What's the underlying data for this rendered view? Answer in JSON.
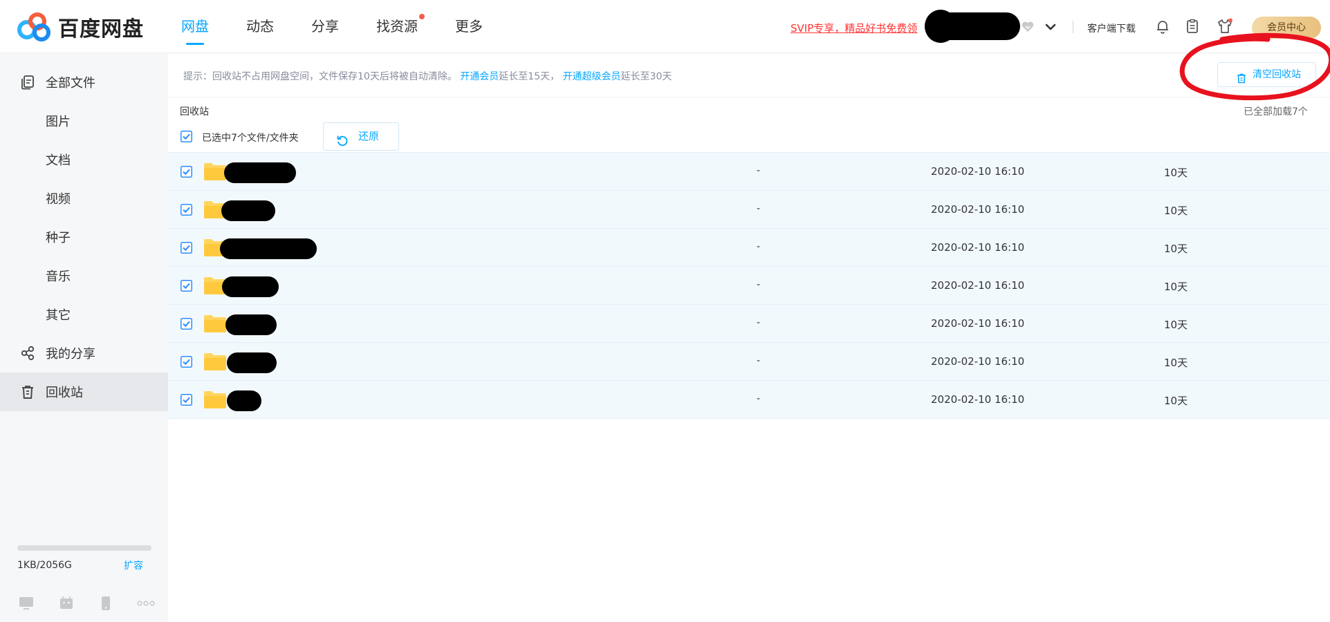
{
  "app": {
    "name": "百度网盘"
  },
  "nav": {
    "items": [
      {
        "label": "网盘",
        "active": true
      },
      {
        "label": "动态",
        "active": false
      },
      {
        "label": "分享",
        "active": false
      },
      {
        "label": "找资源",
        "active": false,
        "dot": true
      },
      {
        "label": "更多",
        "active": false
      }
    ]
  },
  "header": {
    "svip_promo": "SVIP专享，精品好书免费领",
    "client_download": "客户端下载",
    "member_center": "会员中心",
    "icons": [
      "bell-icon",
      "clipboard-icon",
      "skin-icon"
    ]
  },
  "sidebar": {
    "items": [
      {
        "label": "全部文件",
        "icon": "files-icon"
      },
      {
        "label": "图片"
      },
      {
        "label": "文档"
      },
      {
        "label": "视频"
      },
      {
        "label": "种子"
      },
      {
        "label": "音乐"
      },
      {
        "label": "其它"
      },
      {
        "label": "我的分享",
        "icon": "share-icon"
      },
      {
        "label": "回收站",
        "icon": "trash-icon",
        "active": true
      }
    ],
    "quota": {
      "text": "1KB/2056G",
      "used_fraction": 0.0
    },
    "expand_label": "扩容",
    "devices": [
      "computer-icon",
      "android-icon",
      "phone-icon",
      "more-icon"
    ]
  },
  "tip": {
    "prefix": "提示：回收站不占用网盘空间，文件保存10天后将被自动清除。",
    "link1": "开通会员",
    "text1": "延长至15天，",
    "link2": "开通超级会员",
    "text2": "延长至30天"
  },
  "toolbar": {
    "clear_label": "清空回收站",
    "crumb": "回收站",
    "loaded_text": "已全部加载7个",
    "selected_text": "已选中7个文件/文件夹",
    "restore_label": "还原"
  },
  "colors": {
    "accent": "#06a7ff",
    "row_bg": "#f2f9fd",
    "svip": "#ff3333",
    "annotation": "#e8121e"
  },
  "files": [
    {
      "size": "-",
      "date": "2020-02-10 16:10",
      "remaining": "10天"
    },
    {
      "size": "-",
      "date": "2020-02-10 16:10",
      "remaining": "10天"
    },
    {
      "size": "-",
      "date": "2020-02-10 16:10",
      "remaining": "10天"
    },
    {
      "size": "-",
      "date": "2020-02-10 16:10",
      "remaining": "10天"
    },
    {
      "size": "-",
      "date": "2020-02-10 16:10",
      "remaining": "10天"
    },
    {
      "size": "-",
      "date": "2020-02-10 16:10",
      "remaining": "10天"
    },
    {
      "size": "-",
      "date": "2020-02-10 16:10",
      "remaining": "10天"
    }
  ]
}
